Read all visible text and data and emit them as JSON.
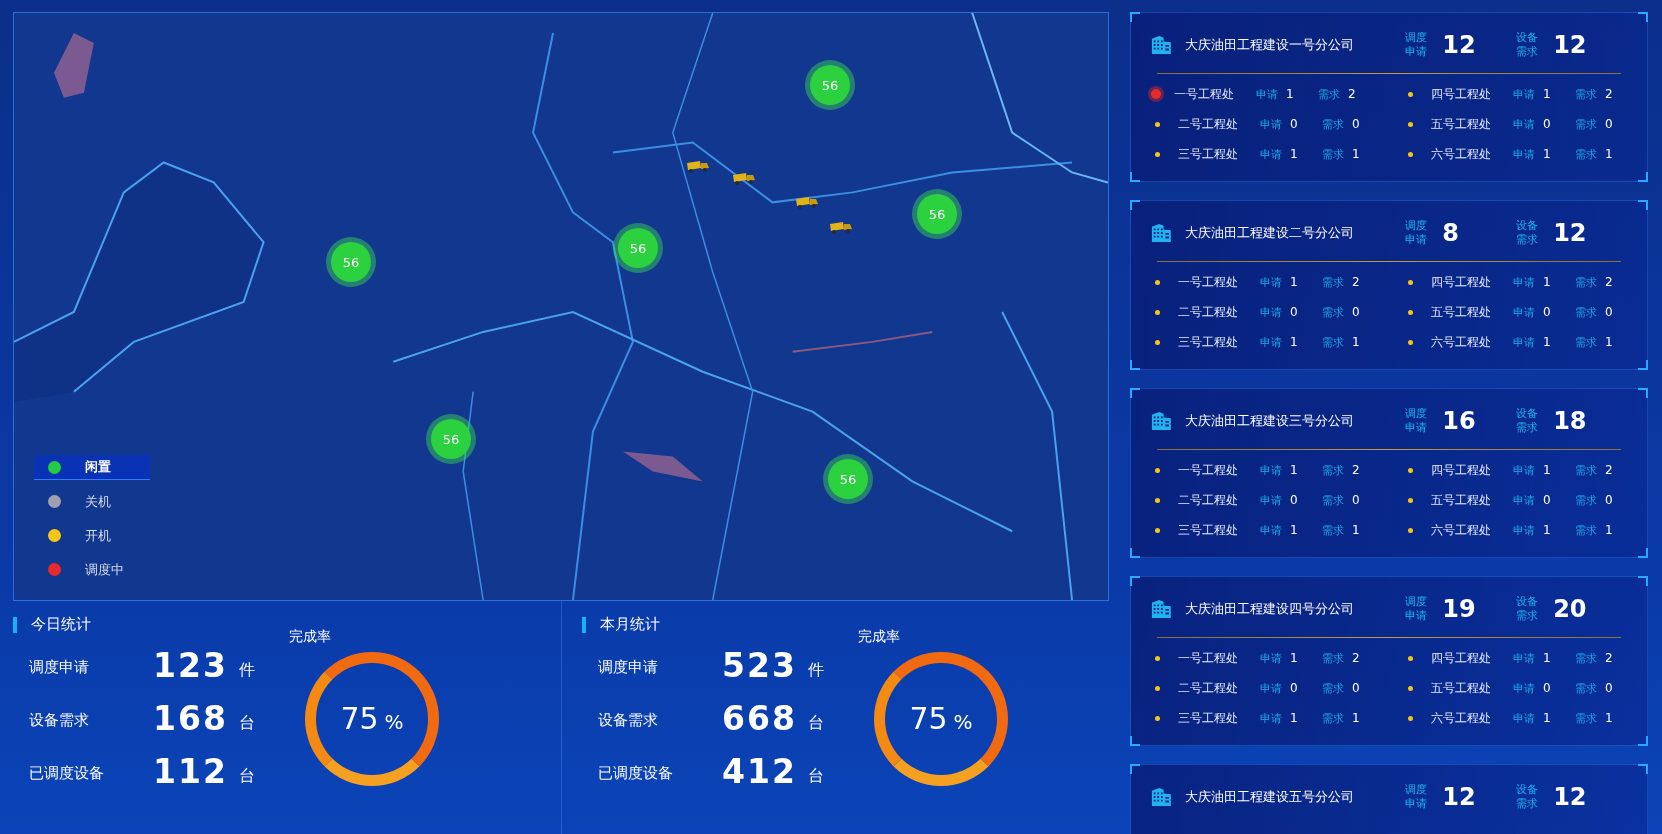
{
  "map": {
    "markers": [
      {
        "label": "56"
      },
      {
        "label": "56"
      },
      {
        "label": "56"
      },
      {
        "label": "56"
      },
      {
        "label": "56"
      },
      {
        "label": "56"
      }
    ],
    "legend": [
      {
        "label": "闲置",
        "color": "#22cc44",
        "selected": true
      },
      {
        "label": "关机",
        "color": "#a0a0b0",
        "selected": false
      },
      {
        "label": "开机",
        "color": "#f5c518",
        "selected": false
      },
      {
        "label": "调度中",
        "color": "#e82a2a",
        "selected": false
      }
    ]
  },
  "stats": [
    {
      "title": "今日统计",
      "rows": [
        {
          "label": "调度申请",
          "value": "123",
          "unit": "件"
        },
        {
          "label": "设备需求",
          "value": "168",
          "unit": "台"
        },
        {
          "label": "已调度设备",
          "value": "112",
          "unit": "台"
        }
      ],
      "rate_label": "完成率",
      "rate_value": "75",
      "rate_unit": "%"
    },
    {
      "title": "本月统计",
      "rows": [
        {
          "label": "调度申请",
          "value": "523",
          "unit": "件"
        },
        {
          "label": "设备需求",
          "value": "668",
          "unit": "台"
        },
        {
          "label": "已调度设备",
          "value": "412",
          "unit": "台"
        }
      ],
      "rate_label": "完成率",
      "rate_value": "75",
      "rate_unit": "%"
    }
  ],
  "companies": [
    {
      "title": "大庆油田工程建设一号分公司",
      "apply_label": "调度申请",
      "apply": "12",
      "demand_label": "设备需求",
      "demand": "12",
      "offices": [
        {
          "name": "一号工程处",
          "color": "#e82a2a",
          "apply_label": "申请",
          "apply": "1",
          "demand_label": "需求",
          "demand": "2"
        },
        {
          "name": "四号工程处",
          "color": "#f5c518",
          "apply_label": "申请",
          "apply": "1",
          "demand_label": "需求",
          "demand": "2"
        },
        {
          "name": "二号工程处",
          "color": "#f5c518",
          "apply_label": "申请",
          "apply": "0",
          "demand_label": "需求",
          "demand": "0"
        },
        {
          "name": "五号工程处",
          "color": "#f5c518",
          "apply_label": "申请",
          "apply": "0",
          "demand_label": "需求",
          "demand": "0"
        },
        {
          "name": "三号工程处",
          "color": "#f5c518",
          "apply_label": "申请",
          "apply": "1",
          "demand_label": "需求",
          "demand": "1"
        },
        {
          "name": "六号工程处",
          "color": "#f5c518",
          "apply_label": "申请",
          "apply": "1",
          "demand_label": "需求",
          "demand": "1"
        }
      ]
    },
    {
      "title": "大庆油田工程建设二号分公司",
      "apply_label": "调度申请",
      "apply": "8",
      "demand_label": "设备需求",
      "demand": "12",
      "offices": [
        {
          "name": "一号工程处",
          "color": "#f5c518",
          "apply_label": "申请",
          "apply": "1",
          "demand_label": "需求",
          "demand": "2"
        },
        {
          "name": "四号工程处",
          "color": "#f5c518",
          "apply_label": "申请",
          "apply": "1",
          "demand_label": "需求",
          "demand": "2"
        },
        {
          "name": "二号工程处",
          "color": "#f5c518",
          "apply_label": "申请",
          "apply": "0",
          "demand_label": "需求",
          "demand": "0"
        },
        {
          "name": "五号工程处",
          "color": "#f5c518",
          "apply_label": "申请",
          "apply": "0",
          "demand_label": "需求",
          "demand": "0"
        },
        {
          "name": "三号工程处",
          "color": "#f5c518",
          "apply_label": "申请",
          "apply": "1",
          "demand_label": "需求",
          "demand": "1"
        },
        {
          "name": "六号工程处",
          "color": "#f5c518",
          "apply_label": "申请",
          "apply": "1",
          "demand_label": "需求",
          "demand": "1"
        }
      ]
    },
    {
      "title": "大庆油田工程建设三号分公司",
      "apply_label": "调度申请",
      "apply": "16",
      "demand_label": "设备需求",
      "demand": "18",
      "offices": [
        {
          "name": "一号工程处",
          "color": "#f5c518",
          "apply_label": "申请",
          "apply": "1",
          "demand_label": "需求",
          "demand": "2"
        },
        {
          "name": "四号工程处",
          "color": "#f5c518",
          "apply_label": "申请",
          "apply": "1",
          "demand_label": "需求",
          "demand": "2"
        },
        {
          "name": "二号工程处",
          "color": "#f5c518",
          "apply_label": "申请",
          "apply": "0",
          "demand_label": "需求",
          "demand": "0"
        },
        {
          "name": "五号工程处",
          "color": "#f5c518",
          "apply_label": "申请",
          "apply": "0",
          "demand_label": "需求",
          "demand": "0"
        },
        {
          "name": "三号工程处",
          "color": "#f5c518",
          "apply_label": "申请",
          "apply": "1",
          "demand_label": "需求",
          "demand": "1"
        },
        {
          "name": "六号工程处",
          "color": "#f5c518",
          "apply_label": "申请",
          "apply": "1",
          "demand_label": "需求",
          "demand": "1"
        }
      ]
    },
    {
      "title": "大庆油田工程建设四号分公司",
      "apply_label": "调度申请",
      "apply": "19",
      "demand_label": "设备需求",
      "demand": "20",
      "offices": [
        {
          "name": "一号工程处",
          "color": "#f5c518",
          "apply_label": "申请",
          "apply": "1",
          "demand_label": "需求",
          "demand": "2"
        },
        {
          "name": "四号工程处",
          "color": "#f5c518",
          "apply_label": "申请",
          "apply": "1",
          "demand_label": "需求",
          "demand": "2"
        },
        {
          "name": "二号工程处",
          "color": "#f5c518",
          "apply_label": "申请",
          "apply": "0",
          "demand_label": "需求",
          "demand": "0"
        },
        {
          "name": "五号工程处",
          "color": "#f5c518",
          "apply_label": "申请",
          "apply": "0",
          "demand_label": "需求",
          "demand": "0"
        },
        {
          "name": "三号工程处",
          "color": "#f5c518",
          "apply_label": "申请",
          "apply": "1",
          "demand_label": "需求",
          "demand": "1"
        },
        {
          "name": "六号工程处",
          "color": "#f5c518",
          "apply_label": "申请",
          "apply": "1",
          "demand_label": "需求",
          "demand": "1"
        }
      ]
    },
    {
      "title": "大庆油田工程建设五号分公司",
      "apply_label": "调度申请",
      "apply": "12",
      "demand_label": "设备需求",
      "demand": "12"
    }
  ]
}
